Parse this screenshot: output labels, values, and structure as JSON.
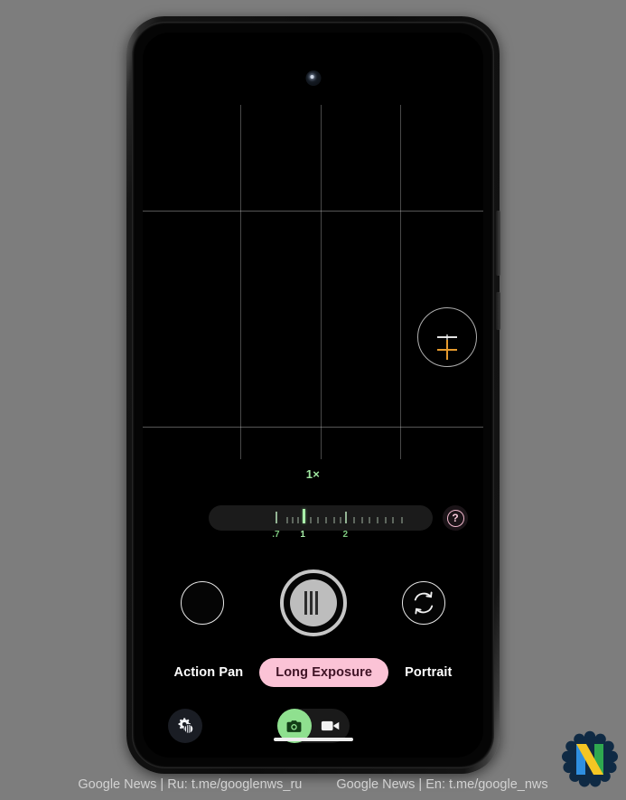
{
  "device": {
    "name": "smartphone-mockup",
    "front_camera_icon": "front-camera-lens-icon"
  },
  "viewfinder": {
    "grid": "3x3-thirds-grid",
    "focus_reticle_icon": "focus-reticle-icon",
    "focus_marker_icon": "focus-marker-icon",
    "focus_marker_color": "#e59a2e"
  },
  "zoom": {
    "current_label": "1×",
    "current_value": 1,
    "accent_color": "#9fe6a0",
    "tick_labels": [
      ".7",
      "1",
      "2"
    ],
    "help_label": "?",
    "help_icon": "question-mark-icon",
    "help_accent": "#f2b8cd"
  },
  "capture": {
    "gallery_name": "gallery-thumbnail",
    "shutter_name": "shutter-button",
    "shutter_icon": "long-exposure-stripes-icon",
    "flip_icon": "camera-flip-icon"
  },
  "modes": {
    "tabs": [
      {
        "label": "Action Pan",
        "selected": false
      },
      {
        "label": "Long Exposure",
        "selected": true
      },
      {
        "label": "Portrait",
        "selected": false
      }
    ],
    "selected_bg": "#fbc3d6",
    "selected_fg": "#3f1325"
  },
  "bottom_bar": {
    "settings_icon": "settings-gear-effects-icon",
    "toggle": {
      "photo_icon": "camera-photo-icon",
      "video_icon": "video-camera-icon",
      "active": "photo",
      "active_color": "#8fe08f"
    },
    "home_indicator": "home-indicator-pill"
  },
  "watermark": {
    "left_text": "Google News | Ru: t.me/googlenws_ru",
    "right_text": "Google News | En: t.me/google_nws",
    "badge_letter": "N",
    "badge_name": "brand-badge-icon",
    "badge_colors": [
      "#0f2a44",
      "#2f8fe0",
      "#f5c623",
      "#2fa84f"
    ]
  }
}
